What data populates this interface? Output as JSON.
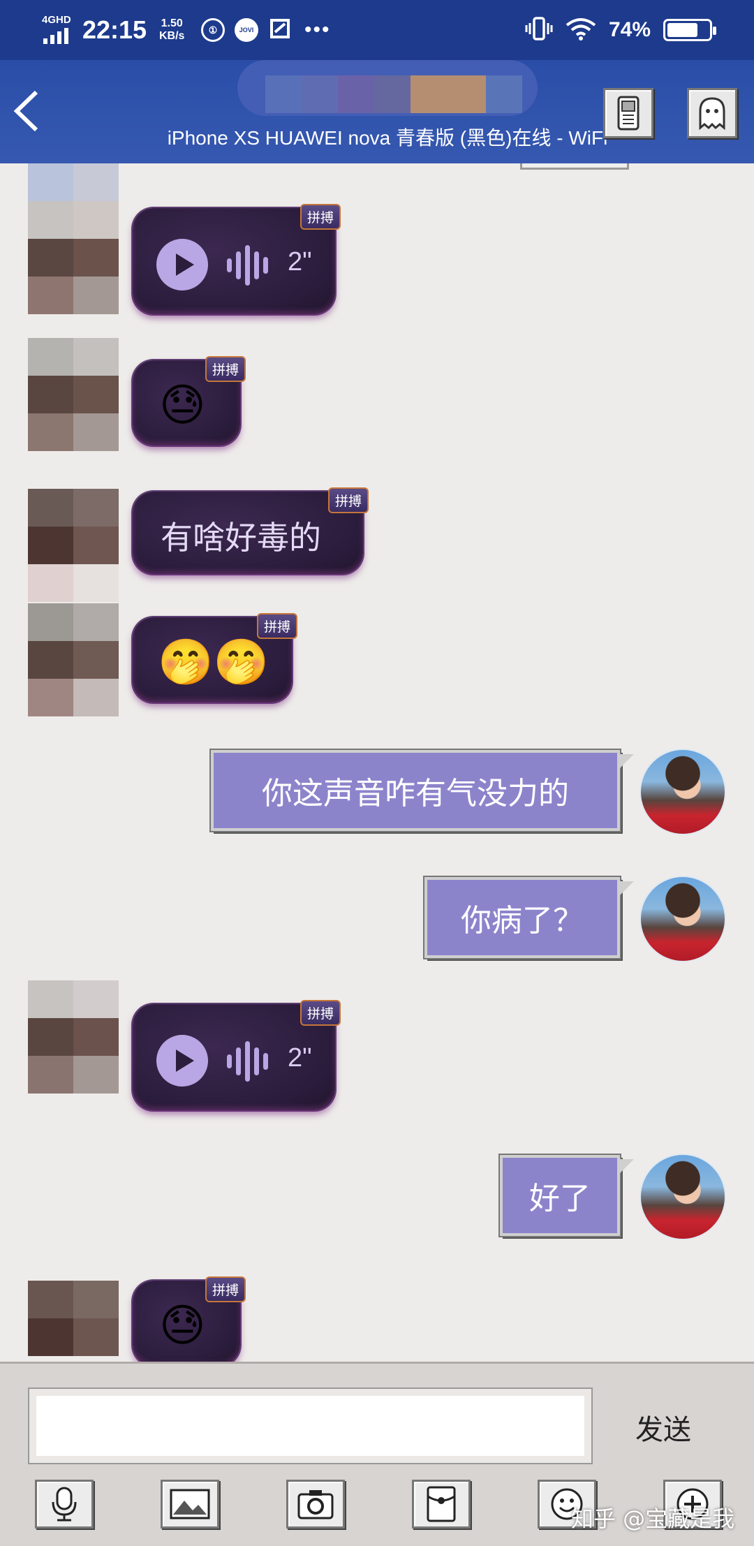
{
  "status_bar": {
    "network": "4GHD",
    "time": "22:15",
    "speed_value": "1.50",
    "speed_unit": "KB/s",
    "icon_app1": "①",
    "icon_app2": "JOVI",
    "dots": "•••",
    "battery_text": "74%",
    "battery_level": 0.74
  },
  "header": {
    "subtitle": "iPhone XS HUAWEI nova 青春版 (黑色)在线 - WiFi"
  },
  "messages": [
    {
      "side": "left",
      "type": "voice",
      "duration": "2\"",
      "badge": "拼搏"
    },
    {
      "side": "left",
      "type": "emoji",
      "emoji": "😓",
      "badge": "拼搏"
    },
    {
      "side": "left",
      "type": "text",
      "text": "有啥好毒的",
      "badge": "拼搏"
    },
    {
      "side": "left",
      "type": "emoji",
      "emoji": "🤭🤭",
      "badge": "拼搏"
    },
    {
      "side": "right",
      "type": "text",
      "text": "你这声音咋有气没力的"
    },
    {
      "side": "right",
      "type": "text",
      "text": "你病了？"
    },
    {
      "side": "left",
      "type": "voice",
      "duration": "2\"",
      "badge": "拼搏"
    },
    {
      "side": "right",
      "type": "text",
      "text": "好了"
    },
    {
      "side": "left",
      "type": "emoji",
      "emoji": "😓",
      "badge": "拼搏"
    }
  ],
  "input": {
    "value": "",
    "send_label": "发送"
  },
  "watermark": "知乎 @宝藏是我"
}
